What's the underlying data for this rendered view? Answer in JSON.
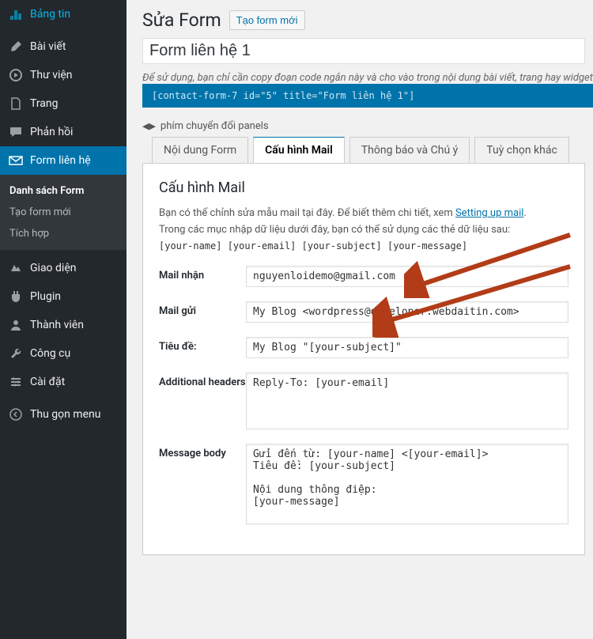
{
  "sidebar": {
    "items": [
      {
        "icon": "dashboard-icon",
        "label": "Bảng tin"
      },
      {
        "icon": "pin-icon",
        "label": "Bài viết"
      },
      {
        "icon": "media-icon",
        "label": "Thư viện"
      },
      {
        "icon": "page-icon",
        "label": "Trang"
      },
      {
        "icon": "comments-icon",
        "label": "Phản hồi"
      },
      {
        "icon": "mail-icon",
        "label": "Form liên hệ"
      },
      {
        "icon": "appearance-icon",
        "label": "Giao diện"
      },
      {
        "icon": "plugin-icon",
        "label": "Plugin"
      },
      {
        "icon": "users-icon",
        "label": "Thành viên"
      },
      {
        "icon": "tools-icon",
        "label": "Công cụ"
      },
      {
        "icon": "settings-icon",
        "label": "Cài đặt"
      },
      {
        "icon": "collapse-icon",
        "label": "Thu gọn menu"
      }
    ],
    "submenu": [
      "Danh sách Form",
      "Tạo form mới",
      "Tích hợp"
    ]
  },
  "header": {
    "title": "Sửa Form",
    "action_btn": "Tạo form mới"
  },
  "form_title": "Form liên hệ 1",
  "helper_text": "Để sử dụng, bạn chỉ cần copy đoạn code ngắn này và cho vào trong nội dung bài viết, trang hay widget:",
  "shortcode": "[contact-form-7 id=\"5\" title=\"Form liên hệ 1\"]",
  "panel_toggle_label": "phím chuyển đổi panels",
  "tabs": [
    "Nội dung Form",
    "Cấu hình Mail",
    "Thông báo và Chú ý",
    "Tuỳ chọn khác"
  ],
  "mail_panel": {
    "heading": "Cấu hình Mail",
    "intro_prefix": "Bạn có thể chỉnh sửa mẫu mail tại đây. Để biết thêm chi tiết, xem ",
    "intro_link": "Setting up mail",
    "intro_suffix": ".",
    "tags_info": "Trong các mục nhập dữ liệu dưới đây, bạn có thể sử dụng các thẻ dữ liệu sau:",
    "mailtags": "[your-name] [your-email] [your-subject] [your-message]",
    "fields": {
      "to_label": "Mail nhận",
      "to_value": "nguyenloidemo@gmail.com",
      "from_label": "Mail gửi",
      "from_value": "My Blog <wordpress@developer.webdaitin.com>",
      "subject_label": "Tiêu đề:",
      "subject_value": "My Blog \"[your-subject]\"",
      "headers_label": "Additional headers",
      "headers_value": "Reply-To: [your-email]",
      "body_label": "Message body",
      "body_value": "Gửi đến từ: [your-name] <[your-email]>\nTiêu đề: [your-subject]\n\nNội dung thông điệp:\n[your-message]"
    }
  }
}
